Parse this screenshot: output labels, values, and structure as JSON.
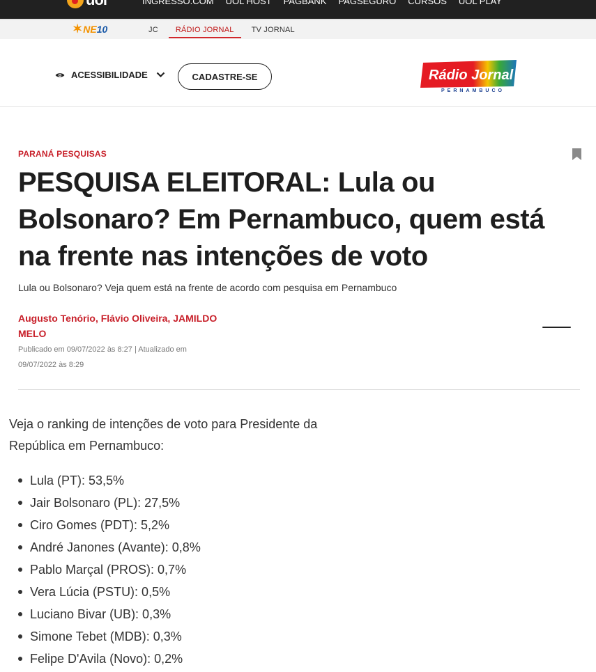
{
  "uol_bar": {
    "logo": "uol",
    "links": [
      "INGRESSO.COM",
      "UOL HOST",
      "PAGBANK",
      "PAGSEGURO",
      "CURSOS",
      "UOL PLAY"
    ]
  },
  "ne10_bar": {
    "logo_prefix": "NE",
    "logo_suffix": "10",
    "nav": [
      "JC",
      "RÁDIO JORNAL",
      "TV JORNAL"
    ],
    "active_index": 1
  },
  "header": {
    "accessibility_label": "ACESSIBILIDADE",
    "signup_label": "CADASTRE-SE",
    "brand_name": "Rádio Jornal",
    "brand_region": "PERNAMBUCO"
  },
  "article": {
    "kicker": "PARANÁ PESQUISAS",
    "headline": "PESQUISA ELEITORAL: Lula ou Bolsonaro? Em Pernambuco, quem está na frente nas intenções de voto",
    "subtitle": "Lula ou Bolsonaro? Veja quem está na frente de acordo com pesquisa em Pernambuco",
    "authors": "Augusto Tenório, Flávio Oliveira, JAMILDO MELO",
    "dates": "Publicado em 09/07/2022 às 8:27 | Atualizado em 09/07/2022 às 8:29",
    "intro": "Veja o ranking de intenções de voto para Presidente da República em Pernambuco:",
    "ranking": [
      "Lula (PT): 53,5%",
      "Jair Bolsonaro (PL): 27,5%",
      "Ciro Gomes (PDT): 5,2%",
      "André Janones (Avante): 0,8%",
      "Pablo Marçal (PROS): 0,7%",
      "Vera Lúcia (PSTU): 0,5%",
      "Luciano Bivar (UB): 0,3%",
      "Simone Tebet (MDB): 0,3%",
      "Felipe D'Avila (Novo): 0,2%"
    ]
  },
  "colors": {
    "accent_red": "#c8202a",
    "uol_bar": "#212121",
    "ne10_orange": "#f39200"
  },
  "icons": {
    "accessibility": "eye-icon",
    "accessibility_toggle": "chevron-down-icon",
    "save": "bookmark-icon"
  }
}
